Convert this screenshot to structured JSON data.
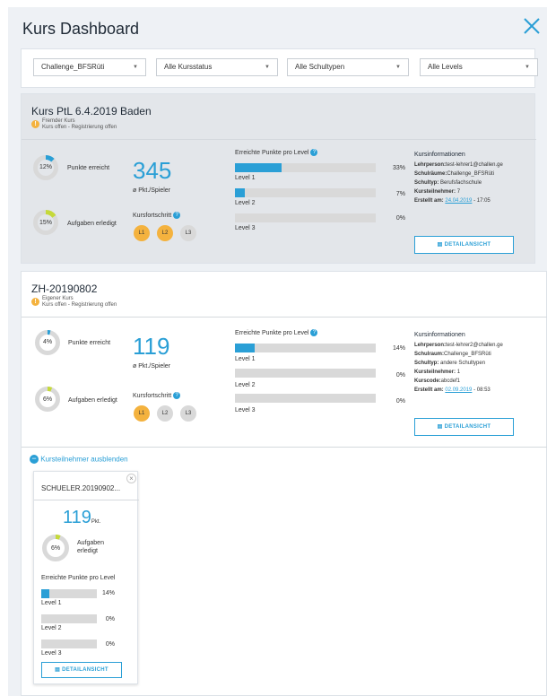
{
  "dashboard": {
    "title": "Kurs Dashboard"
  },
  "filters": [
    "Challenge_BFSRüti",
    "Alle Kursstatus",
    "Alle Schultypen",
    "Alle Levels"
  ],
  "course1": {
    "title": "Kurs PtL 6.4.2019 Baden",
    "type": "Fremder Kurs",
    "status": "Kurs offen - Registrierung offen",
    "points_pct": "12%",
    "points_label": "Punkte erreicht",
    "tasks_pct": "15%",
    "tasks_label": "Aufgaben erledigt",
    "avg_points": "345",
    "avg_label": "ø Pkt./Spieler",
    "progress_title": "Kursfortschritt",
    "steps": [
      "L1",
      "L2",
      "L3"
    ],
    "levels_title": "Erreichte Punkte pro Level",
    "levels": [
      {
        "name": "Level 1",
        "pct": "33%",
        "value": 0.33
      },
      {
        "name": "Level 2",
        "pct": "7%",
        "value": 0.07
      },
      {
        "name": "Level 3",
        "pct": "0%",
        "value": 0.0
      }
    ],
    "info_title": "Kursinformationen",
    "teacher_label": "Lehrperson:",
    "teacher": "test-lehrer1@challen.ge",
    "rooms_label": "Schulräume:",
    "rooms": "Challenge_BFSRüti",
    "schooltype_label": "Schultyp:",
    "schooltype": "Berufsfachschule",
    "participants_label": "Kursteilnehmer:",
    "participants": "7",
    "created_label": "Erstellt am:",
    "created_date": "24.04.2019",
    "created_time": "- 17:05",
    "detail_button": "DETAILANSICHT"
  },
  "course2": {
    "title": "ZH-20190802",
    "type": "Eigener Kurs",
    "status": "Kurs offen - Registrierung offen",
    "points_pct": "4%",
    "points_label": "Punkte erreicht",
    "tasks_pct": "6%",
    "tasks_label": "Aufgaben erledigt",
    "avg_points": "119",
    "avg_label": "ø Pkt./Spieler",
    "progress_title": "Kursfortschritt",
    "steps": [
      "L1",
      "L2",
      "L3"
    ],
    "levels_title": "Erreichte Punkte pro Level",
    "levels": [
      {
        "name": "Level 1",
        "pct": "14%",
        "value": 0.14
      },
      {
        "name": "Level 2",
        "pct": "0%",
        "value": 0.0
      },
      {
        "name": "Level 3",
        "pct": "0%",
        "value": 0.0
      }
    ],
    "info_title": "Kursinformationen",
    "teacher_label": "Lehrperson:",
    "teacher": "test-lehrer2@challen.ge",
    "room_label": "Schulraum:",
    "room": "Challenge_BFSRüti",
    "schooltype_label": "Schultyp:",
    "schooltype": "andere Schultypen",
    "participants_label": "Kursteilnehmer:",
    "participants": "1",
    "code_label": "Kurscode:",
    "code": "abcdef1",
    "created_label": "Erstellt am:",
    "created_date": "02.09.2019",
    "created_time": "- 08:53",
    "detail_button": "DETAILANSICHT",
    "hide_participants": "Kursteilnehmer ausblenden"
  },
  "student": {
    "name": "SCHUELER.20190902...",
    "points": "119",
    "points_unit": "Pkt.",
    "tasks_pct": "6%",
    "tasks_label_1": "Aufgaben",
    "tasks_label_2": "erledigt",
    "levels_title": "Erreichte Punkte pro Level",
    "levels": [
      {
        "name": "Level 1",
        "pct": "14%",
        "value": 0.14
      },
      {
        "name": "Level 2",
        "pct": "0%",
        "value": 0.0
      },
      {
        "name": "Level 3",
        "pct": "0%",
        "value": 0.0
      }
    ],
    "detail_button": "DETAILANSICHT"
  },
  "colors": {
    "accent": "#2a9fd6",
    "badge": "#f4b23e",
    "progress_green": "#c5d93a"
  }
}
